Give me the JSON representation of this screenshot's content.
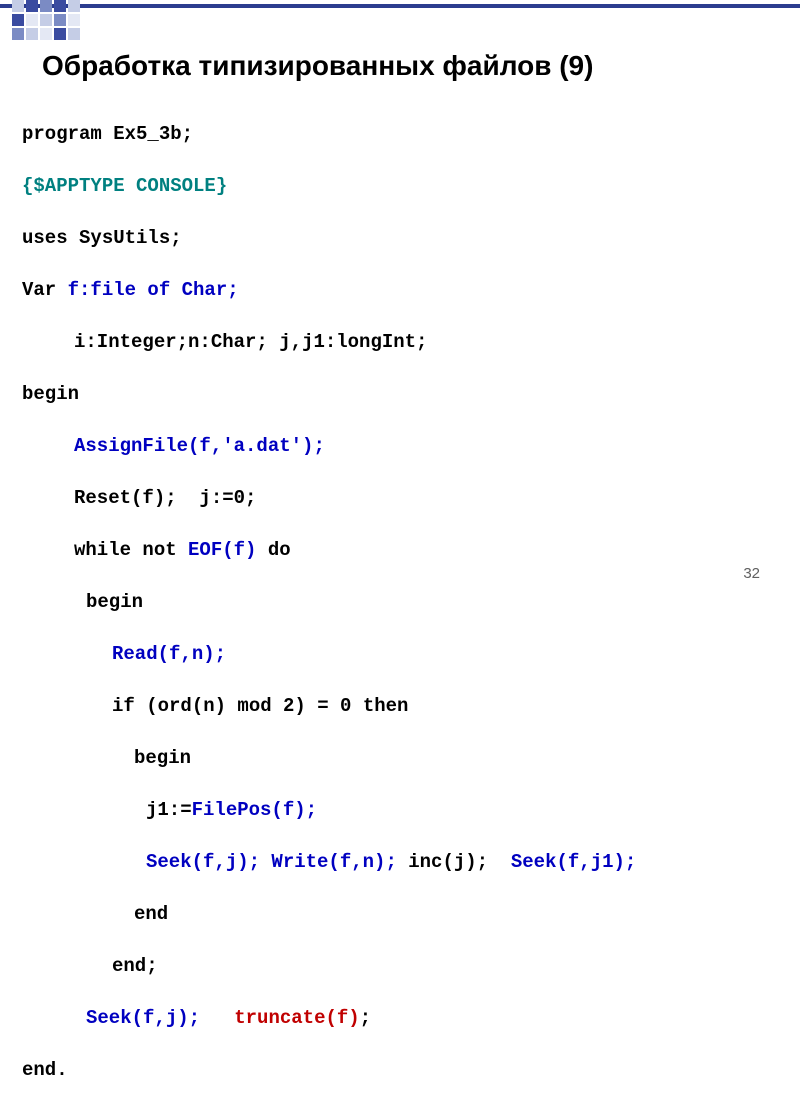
{
  "slide": {
    "title": "Обработка типизированных файлов (9)",
    "page_number": "32"
  },
  "code": {
    "l01a": "program Ex5_3b;",
    "l02a": "{$APPTYPE CONSOLE}",
    "l03a": "uses SysUtils;",
    "l04a": "Var ",
    "l04b": "f:file of Char;",
    "l05a": "i:Integer;n:Char; j,j1:longInt;",
    "l06a": "begin",
    "l07a": "AssignFile(f,'a.dat');",
    "l08a": "Reset(f);  j:=0;",
    "l09a": "while not ",
    "l09b": "EOF(f)",
    "l09c": " do",
    "l10a": "begin",
    "l11a": "Read(f,n);",
    "l12a": "if (ord(n) mod 2) = 0 then",
    "l13a": "begin",
    "l14a": "j1:=",
    "l14b": "FilePos(f);",
    "l15a": "Seek(f,j); Write(f,n);",
    "l15b": " inc(j);  ",
    "l15c": "Seek(f,j1);",
    "l16a": "end",
    "l17a": "end;",
    "l18a": "Seek(f,j);",
    "l18b": "   ",
    "l18c": "truncate(f)",
    "l18d": ";",
    "l19a": "end."
  }
}
